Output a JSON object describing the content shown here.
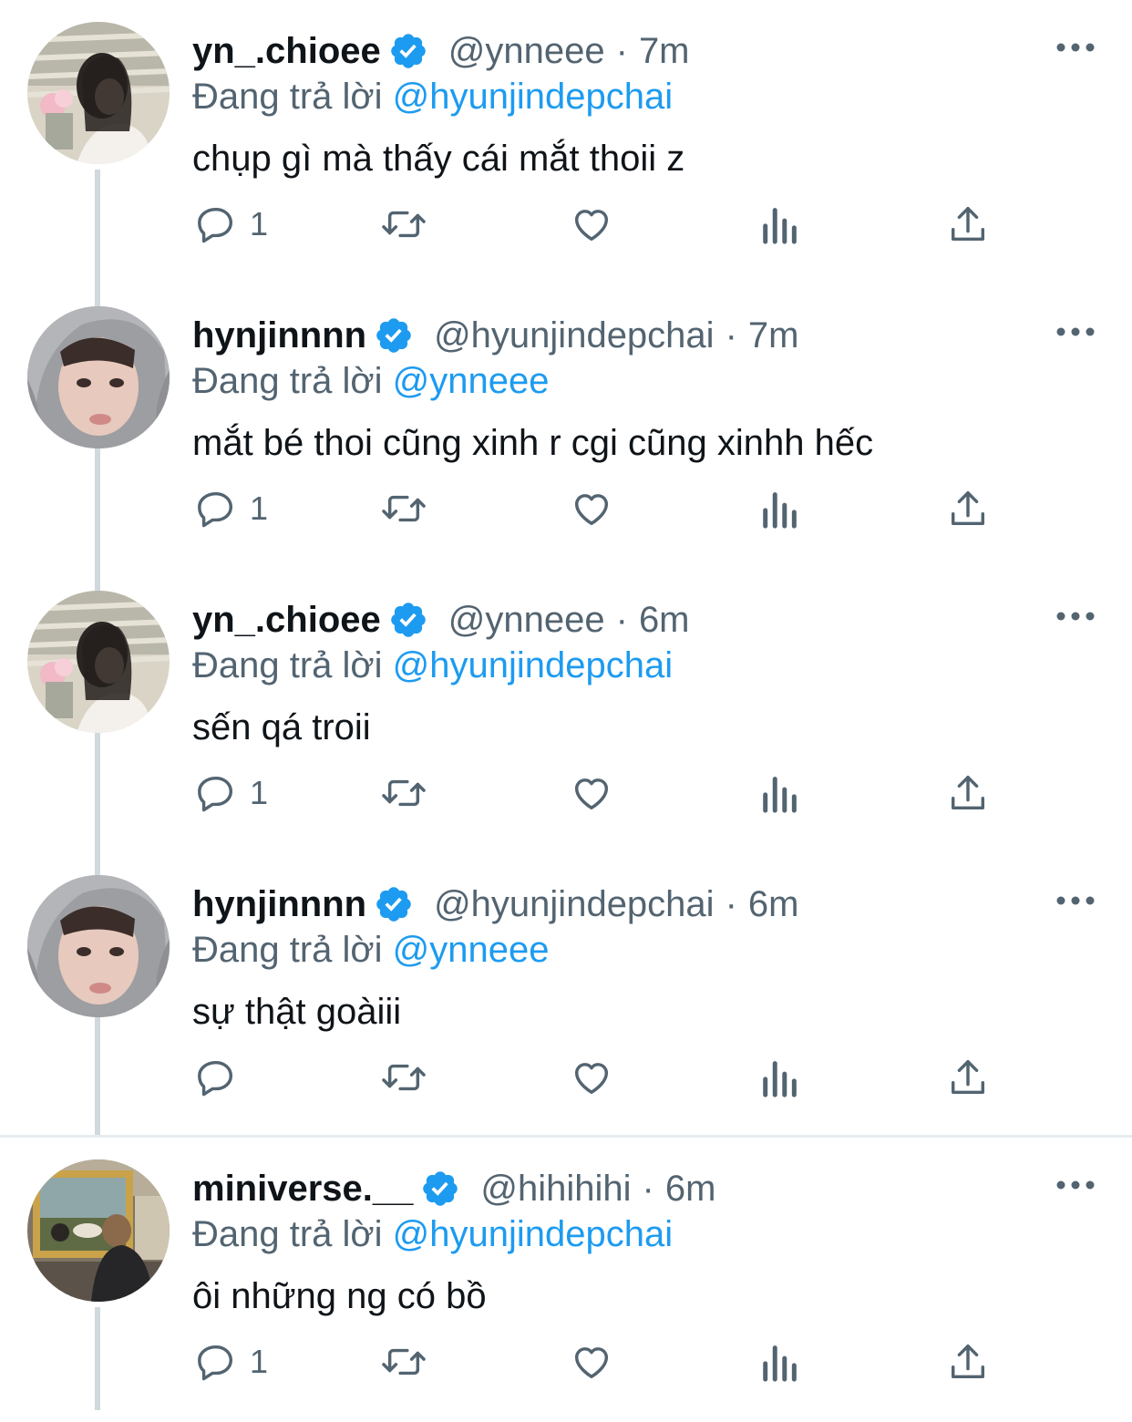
{
  "colors": {
    "link": "#1d9bf0",
    "secondary_text": "#536471",
    "primary_text": "#0f1419",
    "thread_line": "#cfd9de",
    "verified_badge": "#1d9bf0"
  },
  "tweets": [
    {
      "display_name": "yn_.chioee",
      "verified": true,
      "handle": "@ynneee",
      "separator": "·",
      "time": "7m",
      "reply_prefix": "Đang trả lời",
      "reply_to": "@hyunjindepchai",
      "text": "chụp gì mà thấy cái mắt thoii z",
      "reply_count": "1",
      "avatar": "avatar-girl-photo"
    },
    {
      "display_name": "hynjinnnn",
      "verified": true,
      "handle": "@hyunjindepchai",
      "separator": "·",
      "time": "7m",
      "reply_prefix": "Đang trả lời",
      "reply_to": "@ynneee",
      "text": "mắt bé thoi cũng xinh r cgi cũng xinhh hếc",
      "reply_count": "1",
      "avatar": "avatar-hoodie-photo"
    },
    {
      "display_name": "yn_.chioee",
      "verified": true,
      "handle": "@ynneee",
      "separator": "·",
      "time": "6m",
      "reply_prefix": "Đang trả lời",
      "reply_to": "@hyunjindepchai",
      "text": "sến qá troii",
      "reply_count": "1",
      "avatar": "avatar-girl-photo"
    },
    {
      "display_name": "hynjinnnn",
      "verified": true,
      "handle": "@hyunjindepchai",
      "separator": "·",
      "time": "6m",
      "reply_prefix": "Đang trả lời",
      "reply_to": "@ynneee",
      "text": "sự thật goàiii",
      "reply_count": "",
      "avatar": "avatar-hoodie-photo"
    },
    {
      "display_name": "miniverse.__",
      "verified": true,
      "handle": "@hihihihi",
      "separator": "·",
      "time": "6m",
      "reply_prefix": "Đang trả lời",
      "reply_to": "@hyunjindepchai",
      "text": "ôi những ng có bồ",
      "reply_count": "1",
      "avatar": "avatar-museum-photo"
    }
  ],
  "icons": {
    "reply": "reply-icon",
    "retweet": "retweet-icon",
    "like": "like-icon",
    "views": "views-icon",
    "share": "share-icon",
    "more": "more-icon",
    "verified": "verified-badge-icon"
  }
}
